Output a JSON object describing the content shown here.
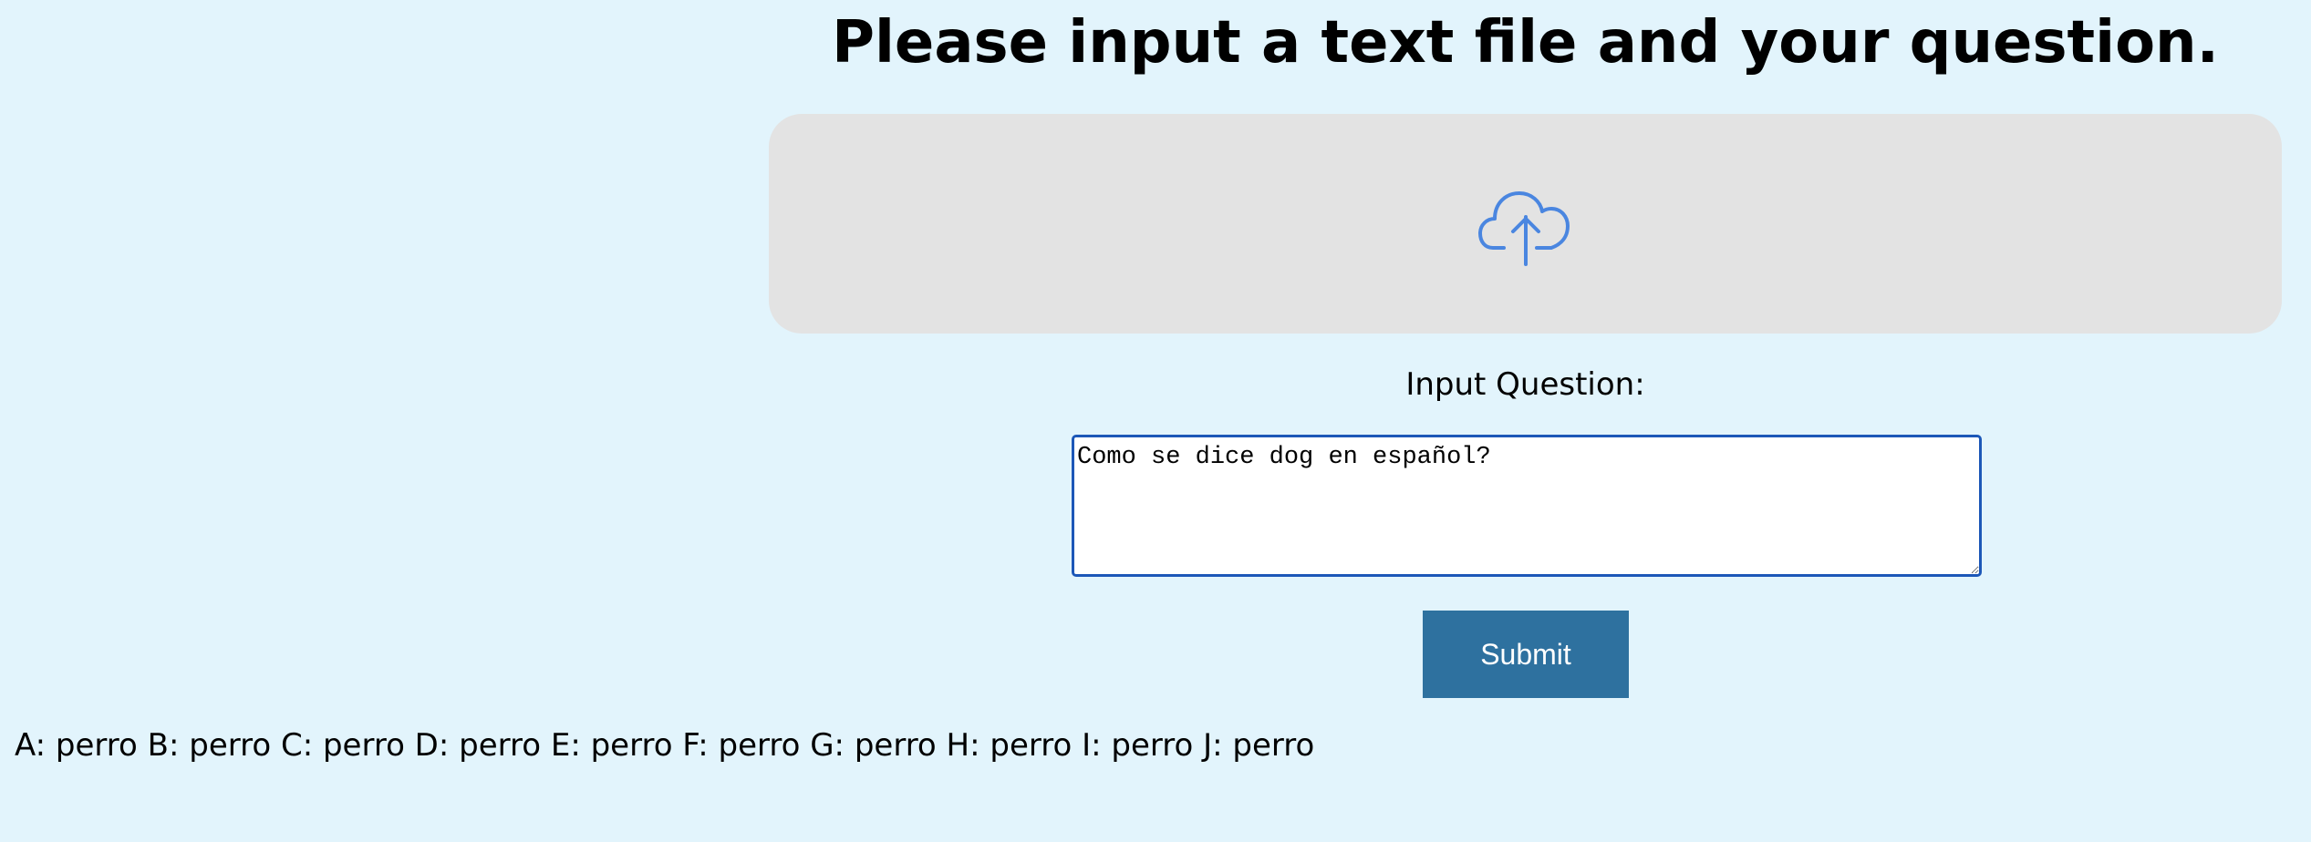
{
  "header": {
    "title": "Please input a text file and your question."
  },
  "upload": {
    "icon": "cloud-upload-icon",
    "icon_color": "#4a86e0"
  },
  "question": {
    "label": "Input Question:",
    "value": "Como se dice dog en español?"
  },
  "submit": {
    "label": "Submit"
  },
  "answers": {
    "text": "A: perro B: perro C: perro D: perro E: perro F: perro G: perro H: perro I: perro J: perro"
  },
  "colors": {
    "page_background": "#e2f4fc",
    "dropzone_background": "#e3e3e3",
    "input_border": "#1c57b8",
    "button_background": "#2e719f",
    "button_text": "#ffffff"
  }
}
